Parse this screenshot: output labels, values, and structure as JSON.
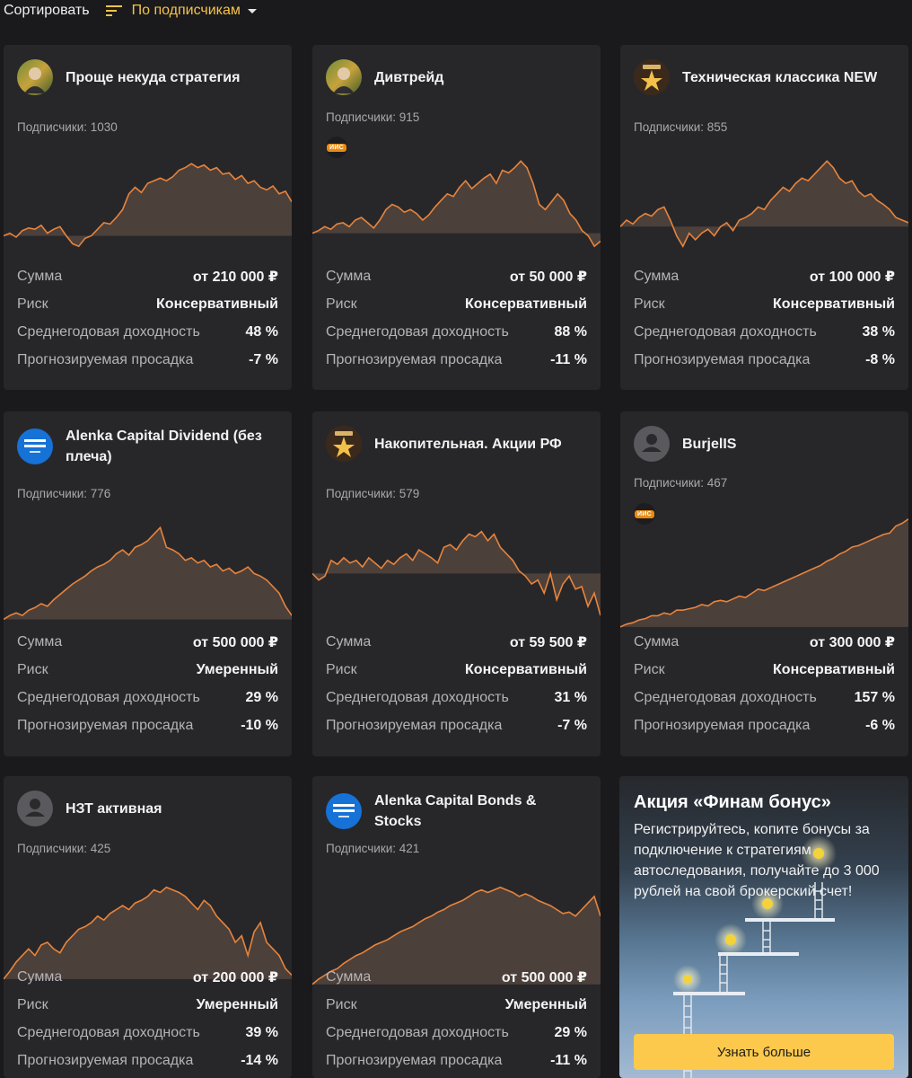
{
  "sort": {
    "label": "Сортировать",
    "selected": "По подписчикам"
  },
  "colors": {
    "accent": "#f5c34a",
    "chart_line": "#e8843c",
    "badge": "#e88b12",
    "button": "#fdc94c"
  },
  "cards": [
    {
      "title": "Проще некуда стратегия",
      "avatar": "photo-avatar",
      "subscribers": "Подписчики: 1030",
      "iis": "",
      "sum_label": "Сумма",
      "sum": "от 210 000 ₽",
      "risk_label": "Риск",
      "risk": "Консервативный",
      "yield_label": "Среднегодовая доходность",
      "yield": "48 %",
      "dd_label": "Прогнозируемая просадка",
      "drawdown": "-7 %",
      "chart": [
        0.62,
        0.6,
        0.63,
        0.58,
        0.56,
        0.57,
        0.54,
        0.6,
        0.57,
        0.55,
        0.62,
        0.68,
        0.7,
        0.64,
        0.62,
        0.57,
        0.52,
        0.53,
        0.48,
        0.42,
        0.3,
        0.25,
        0.29,
        0.22,
        0.2,
        0.18,
        0.2,
        0.17,
        0.12,
        0.1,
        0.07,
        0.1,
        0.08,
        0.12,
        0.1,
        0.15,
        0.14,
        0.19,
        0.16,
        0.22,
        0.2,
        0.25,
        0.27,
        0.24,
        0.3,
        0.28,
        0.36
      ]
    },
    {
      "title": "Дивтрейд",
      "avatar": "photo-avatar",
      "subscribers": "Подписчики: 915",
      "iis": "ИИС",
      "sum_label": "Сумма",
      "sum": "от 50 000 ₽",
      "risk_label": "Риск",
      "risk": "Консервативный",
      "yield_label": "Среднегодовая доходность",
      "yield": "88 %",
      "dd_label": "Прогнозируемая просадка",
      "drawdown": "-11 %",
      "chart": [
        0.6,
        0.58,
        0.55,
        0.57,
        0.53,
        0.52,
        0.55,
        0.5,
        0.48,
        0.52,
        0.56,
        0.5,
        0.42,
        0.38,
        0.4,
        0.44,
        0.42,
        0.45,
        0.5,
        0.46,
        0.4,
        0.35,
        0.3,
        0.32,
        0.25,
        0.2,
        0.26,
        0.22,
        0.18,
        0.15,
        0.22,
        0.12,
        0.14,
        0.1,
        0.05,
        0.1,
        0.22,
        0.38,
        0.42,
        0.36,
        0.3,
        0.35,
        0.45,
        0.5,
        0.58,
        0.62,
        0.7,
        0.66
      ]
    },
    {
      "title": "Техническая классика NEW",
      "avatar": "finam-star-avatar",
      "subscribers": "Подписчики: 855",
      "iis": "",
      "sum_label": "Сумма",
      "sum": "от 100 000 ₽",
      "risk_label": "Риск",
      "risk": "Консервативный",
      "yield_label": "Среднегодовая доходность",
      "yield": "38 %",
      "dd_label": "Прогнозируемая просадка",
      "drawdown": "-8 %",
      "chart": [
        0.55,
        0.5,
        0.53,
        0.48,
        0.45,
        0.47,
        0.42,
        0.4,
        0.5,
        0.62,
        0.7,
        0.6,
        0.65,
        0.6,
        0.57,
        0.62,
        0.55,
        0.52,
        0.58,
        0.5,
        0.48,
        0.45,
        0.4,
        0.42,
        0.35,
        0.3,
        0.25,
        0.28,
        0.22,
        0.18,
        0.2,
        0.15,
        0.1,
        0.05,
        0.1,
        0.18,
        0.22,
        0.2,
        0.28,
        0.32,
        0.3,
        0.35,
        0.38,
        0.42,
        0.48,
        0.5,
        0.52
      ]
    },
    {
      "title": "Alenka Capital Dividend (без плеча)",
      "avatar": "alenka-capital-logo",
      "subscribers": "Подписчики: 776",
      "iis": "",
      "sum_label": "Сумма",
      "sum": "от 500 000 ₽",
      "risk_label": "Риск",
      "risk": "Умеренный",
      "yield_label": "Среднегодовая доходность",
      "yield": "29 %",
      "dd_label": "Прогнозируемая просадка",
      "drawdown": "-10 %",
      "chart": [
        0.75,
        0.72,
        0.7,
        0.72,
        0.68,
        0.66,
        0.63,
        0.65,
        0.6,
        0.56,
        0.52,
        0.48,
        0.45,
        0.42,
        0.38,
        0.35,
        0.33,
        0.3,
        0.25,
        0.22,
        0.26,
        0.2,
        0.18,
        0.15,
        0.1,
        0.05,
        0.2,
        0.22,
        0.25,
        0.3,
        0.28,
        0.32,
        0.3,
        0.35,
        0.33,
        0.38,
        0.36,
        0.4,
        0.38,
        0.35,
        0.4,
        0.42,
        0.45,
        0.5,
        0.55,
        0.65,
        0.72
      ]
    },
    {
      "title": "Накопительная. Акции РФ",
      "avatar": "finam-star-avatar",
      "subscribers": "Подписчики: 579",
      "iis": "",
      "sum_label": "Сумма",
      "sum": "от 59 500 ₽",
      "risk_label": "Риск",
      "risk": "Консервативный",
      "yield_label": "Среднегодовая доходность",
      "yield": "31 %",
      "dd_label": "Прогнозируемая просадка",
      "drawdown": "-7 %",
      "chart": [
        0.4,
        0.45,
        0.42,
        0.3,
        0.33,
        0.28,
        0.32,
        0.3,
        0.35,
        0.28,
        0.32,
        0.36,
        0.3,
        0.33,
        0.28,
        0.25,
        0.3,
        0.22,
        0.25,
        0.28,
        0.32,
        0.2,
        0.18,
        0.22,
        0.15,
        0.1,
        0.12,
        0.08,
        0.15,
        0.1,
        0.2,
        0.25,
        0.3,
        0.38,
        0.42,
        0.48,
        0.45,
        0.55,
        0.4,
        0.6,
        0.48,
        0.42,
        0.52,
        0.5,
        0.65,
        0.55,
        0.72
      ]
    },
    {
      "title": "BurjelIS",
      "avatar": "default-user-avatar",
      "subscribers": "Подписчики: 467",
      "iis": "ИИС",
      "sum_label": "Сумма",
      "sum": "от 300 000 ₽",
      "risk_label": "Риск",
      "risk": "Консервативный",
      "yield_label": "Среднегодовая доходность",
      "yield": "157 %",
      "dd_label": "Прогнозируемая просадка",
      "drawdown": "-6 %",
      "chart": [
        0.82,
        0.8,
        0.79,
        0.77,
        0.76,
        0.74,
        0.74,
        0.72,
        0.73,
        0.7,
        0.7,
        0.69,
        0.68,
        0.66,
        0.67,
        0.64,
        0.63,
        0.64,
        0.62,
        0.6,
        0.61,
        0.58,
        0.55,
        0.56,
        0.54,
        0.52,
        0.5,
        0.48,
        0.46,
        0.44,
        0.42,
        0.4,
        0.38,
        0.35,
        0.33,
        0.3,
        0.28,
        0.25,
        0.24,
        0.22,
        0.2,
        0.18,
        0.16,
        0.15,
        0.1,
        0.08,
        0.05
      ]
    },
    {
      "title": "НЗТ активная",
      "avatar": "default-user-avatar",
      "subscribers": "Подписчики: 425",
      "iis": "",
      "sum_label": "Сумма",
      "sum": "от 200 000 ₽",
      "risk_label": "Риск",
      "risk": "Умеренный",
      "yield_label": "Среднегодовая доходность",
      "yield": "39 %",
      "dd_label": "Прогнозируемая просадка",
      "drawdown": "-14 %",
      "chart": [
        0.78,
        0.72,
        0.65,
        0.6,
        0.55,
        0.6,
        0.52,
        0.5,
        0.55,
        0.58,
        0.5,
        0.45,
        0.4,
        0.38,
        0.35,
        0.3,
        0.33,
        0.28,
        0.25,
        0.22,
        0.25,
        0.2,
        0.18,
        0.15,
        0.1,
        0.12,
        0.08,
        0.1,
        0.12,
        0.15,
        0.2,
        0.25,
        0.18,
        0.22,
        0.3,
        0.35,
        0.4,
        0.5,
        0.45,
        0.6,
        0.42,
        0.35,
        0.5,
        0.55,
        0.6,
        0.7,
        0.75
      ]
    },
    {
      "title": "Alenka Capital Bonds & Stocks",
      "avatar": "alenka-capital-logo",
      "subscribers": "Подписчики: 421",
      "iis": "",
      "sum_label": "Сумма",
      "sum": "от 500 000 ₽",
      "risk_label": "Риск",
      "risk": "Умеренный",
      "yield_label": "Среднегодовая доходность",
      "yield": "29 %",
      "dd_label": "Прогнозируемая просадка",
      "drawdown": "-11 %",
      "chart": [
        0.82,
        0.78,
        0.75,
        0.72,
        0.7,
        0.66,
        0.63,
        0.6,
        0.58,
        0.55,
        0.52,
        0.5,
        0.48,
        0.45,
        0.42,
        0.4,
        0.38,
        0.35,
        0.32,
        0.3,
        0.27,
        0.25,
        0.22,
        0.2,
        0.18,
        0.15,
        0.12,
        0.1,
        0.12,
        0.1,
        0.08,
        0.1,
        0.12,
        0.15,
        0.13,
        0.15,
        0.18,
        0.2,
        0.22,
        0.25,
        0.28,
        0.27,
        0.3,
        0.25,
        0.2,
        0.15,
        0.3
      ]
    }
  ],
  "promo": {
    "title": "Акция «Финам бонус»",
    "text": "Регистрируйтесь, копите бонусы за подключение к стратегиям автоследования, получайте до 3 000 рублей на свой брокерский счет!",
    "button": "Узнать больше"
  }
}
